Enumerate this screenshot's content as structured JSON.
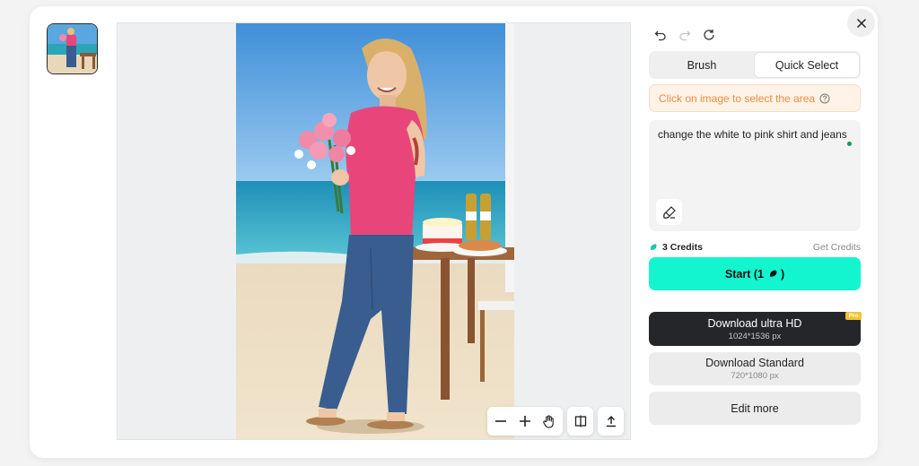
{
  "history": {
    "undo_icon": "undo-icon",
    "redo_icon": "redo-icon",
    "reset_icon": "reset-icon"
  },
  "mode_tabs": [
    {
      "label": "Brush",
      "active": false
    },
    {
      "label": "Quick Select",
      "active": true
    }
  ],
  "hint": {
    "text": "Click on image to select the area"
  },
  "prompt": {
    "value": "change the white to pink shirt and jeans"
  },
  "credits": {
    "label": "3 Credits",
    "get_label": "Get Credits"
  },
  "start": {
    "label": "Start (1",
    "close_paren": ")"
  },
  "download_hd": {
    "label": "Download ultra HD",
    "size": "1024*1536 px",
    "badge": "Pro"
  },
  "download_standard": {
    "label": "Download Standard",
    "size": "720*1080 px"
  },
  "edit_more": {
    "label": "Edit more"
  },
  "colors": {
    "accent": "#13f5cf",
    "dark_button": "#25262a",
    "hint_text": "#f08a3c",
    "pro_badge": "#f2c433",
    "shirt": "#e8467a",
    "jeans": "#3a5d8f"
  }
}
